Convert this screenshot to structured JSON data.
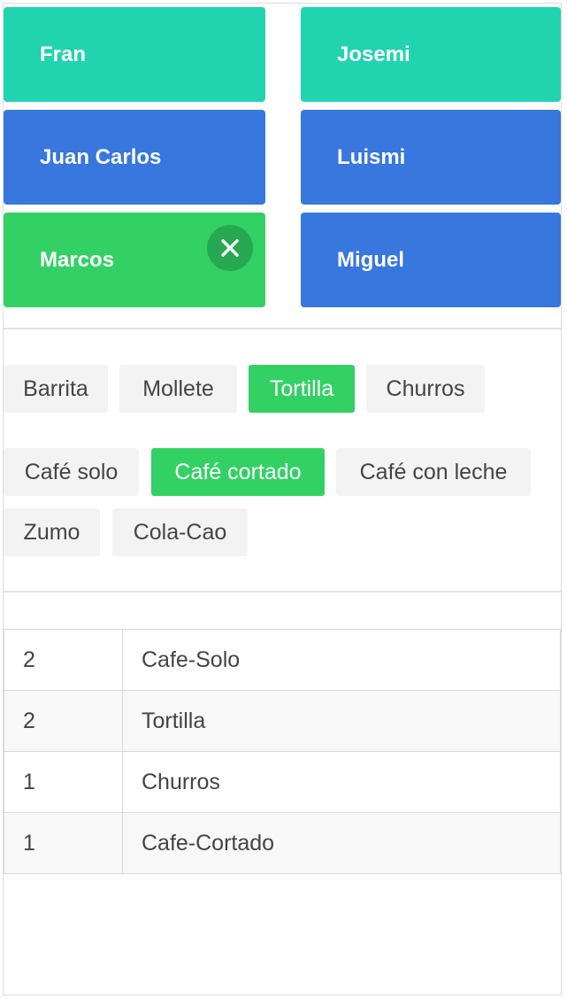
{
  "people": [
    {
      "name": "Fran",
      "color": "#22d3b0"
    },
    {
      "name": "Josemi",
      "color": "#22d3b0"
    },
    {
      "name": "Juan Carlos",
      "color": "#3777de"
    },
    {
      "name": "Luismi",
      "color": "#3777de"
    },
    {
      "name": "Marcos",
      "color": "#33d164",
      "selected": true
    },
    {
      "name": "Miguel",
      "color": "#3777de"
    }
  ],
  "food": [
    {
      "label": "Barrita",
      "active": false
    },
    {
      "label": "Mollete",
      "active": false
    },
    {
      "label": "Tortilla",
      "active": true
    },
    {
      "label": "Churros",
      "active": false
    }
  ],
  "drinks": [
    {
      "label": "Café solo",
      "active": false
    },
    {
      "label": "Café cortado",
      "active": true
    },
    {
      "label": "Café con leche",
      "active": false
    },
    {
      "label": "Zumo",
      "active": false
    },
    {
      "label": "Cola-Cao",
      "active": false
    }
  ],
  "orders": [
    {
      "qty": "2",
      "item": "Cafe-Solo"
    },
    {
      "qty": "2",
      "item": "Tortilla"
    },
    {
      "qty": "1",
      "item": "Churros"
    },
    {
      "qty": "1",
      "item": "Cafe-Cortado"
    }
  ],
  "icons": {
    "remove": "close-icon"
  },
  "colors": {
    "teal": "#22d3b0",
    "blue": "#3777de",
    "green": "#33d164",
    "remove_bg": "#27a852"
  }
}
